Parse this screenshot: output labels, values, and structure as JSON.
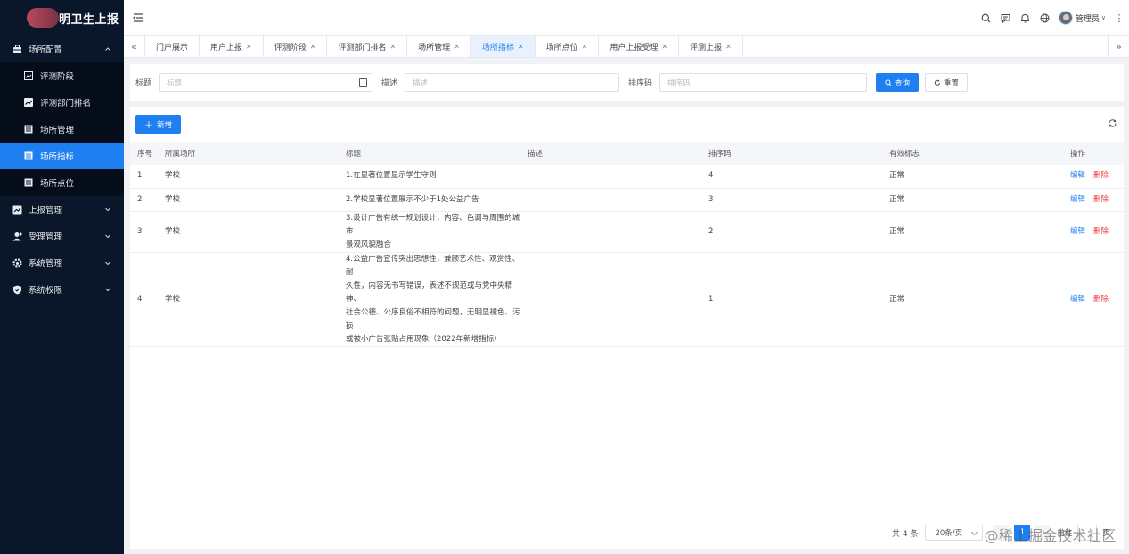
{
  "app": {
    "title": "明卫生上报"
  },
  "sidebar": {
    "groups": [
      {
        "label": "场所配置",
        "icon": "briefcase-icon"
      },
      {
        "label": "上报管理",
        "icon": "trend-chart-icon"
      },
      {
        "label": "受理管理",
        "icon": "user-add-icon"
      },
      {
        "label": "系统管理",
        "icon": "gear-icon"
      },
      {
        "label": "系统权限",
        "icon": "shield-icon"
      }
    ],
    "subitems": [
      {
        "label": "评测阶段",
        "icon": "picture-icon"
      },
      {
        "label": "评测部门排名",
        "icon": "trend-chart-icon"
      },
      {
        "label": "场所管理",
        "icon": "document-icon"
      },
      {
        "label": "场所指标",
        "icon": "document-icon"
      },
      {
        "label": "场所点位",
        "icon": "document-icon"
      }
    ]
  },
  "header": {
    "user_name": "管理员",
    "icons": [
      "search-icon",
      "message-icon",
      "bell-icon",
      "globe-icon"
    ]
  },
  "tabs": [
    {
      "label": "门户展示",
      "closable": false
    },
    {
      "label": "用户上报",
      "closable": true
    },
    {
      "label": "评测阶段",
      "closable": true
    },
    {
      "label": "评测部门排名",
      "closable": true
    },
    {
      "label": "场所管理",
      "closable": true
    },
    {
      "label": "场所指标",
      "closable": true,
      "active": true
    },
    {
      "label": "场所点位",
      "closable": true
    },
    {
      "label": "用户上报受理",
      "closable": true
    },
    {
      "label": "评测上报",
      "closable": true
    }
  ],
  "search": {
    "title_label": "标题",
    "title_placeholder": "标题",
    "desc_label": "描述",
    "desc_placeholder": "描述",
    "sort_label": "排序码",
    "sort_placeholder": "排序码",
    "query_label": "查询",
    "reset_label": "重置"
  },
  "toolbar": {
    "add_label": "新增"
  },
  "table": {
    "columns": [
      "序号",
      "所属场所",
      "标题",
      "描述",
      "排序码",
      "有效标志",
      "操作"
    ],
    "rows": [
      {
        "no": "1",
        "place": "学校",
        "title_lines": [
          "1.在显著位置显示学生守则"
        ],
        "desc": "",
        "sort": "4",
        "status": "正常"
      },
      {
        "no": "2",
        "place": "学校",
        "title_lines": [
          "2.学校显著位置展示不少于1处公益广告"
        ],
        "desc": "",
        "sort": "3",
        "status": "正常"
      },
      {
        "no": "3",
        "place": "学校",
        "title_lines": [
          "3.设计广告有统一规划设计，内容、色调与周围的城市",
          "景观风貌融合"
        ],
        "desc": "",
        "sort": "2",
        "status": "正常"
      },
      {
        "no": "4",
        "place": "学校",
        "title_lines": [
          "4.公益广告宣传突出思想性，兼顾艺术性、观赏性、耐",
          "久性，内容无书写错误，表述不规范或与党中央精神、",
          "社会公德、公序良俗不相符的问题，无明显褪色、污损",
          "或被小广告张贴占用现象（2022年新增指标）"
        ],
        "desc": "",
        "sort": "1",
        "status": "正常"
      }
    ],
    "edit_label": "编辑",
    "delete_label": "删除"
  },
  "pagination": {
    "total_text": "共 4 条",
    "page_size": "20条/页",
    "current_page": "1",
    "goto_prefix": "前往",
    "goto_suffix": "页"
  },
  "watermark": "@稀土掘金技术社区",
  "colors": {
    "accent": "#1e7ff0",
    "danger": "#f0333f",
    "sidebar_bg": "#0a1629"
  }
}
